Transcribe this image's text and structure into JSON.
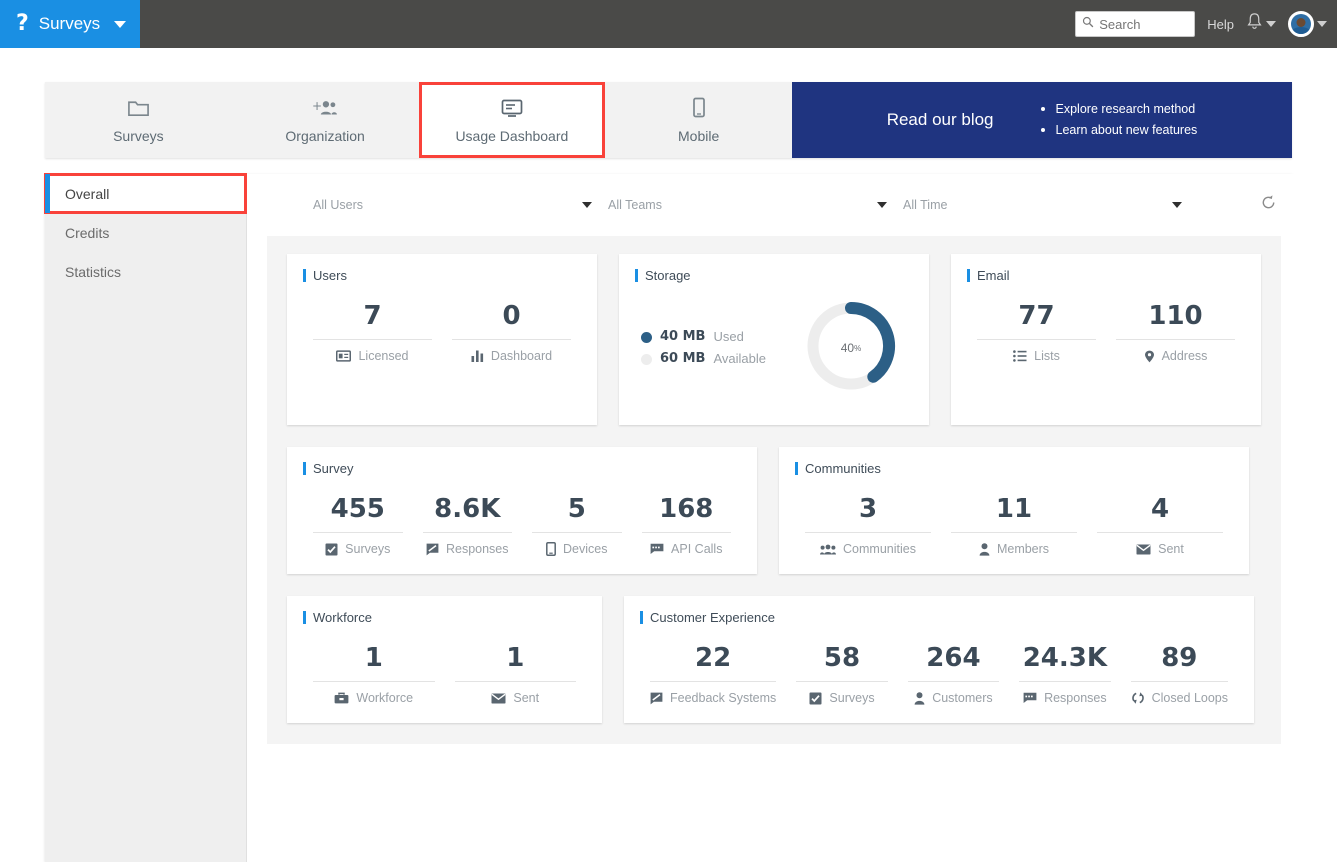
{
  "topbar": {
    "logo_glyph": "?",
    "brand": "Surveys",
    "search_placeholder": "Search",
    "search_value": "",
    "help": "Help",
    "icons": {
      "search": "search-icon",
      "bell": "bell-icon",
      "avatar": "avatar"
    }
  },
  "tabs": [
    {
      "label": "Surveys",
      "icon": "folder-icon",
      "active": false
    },
    {
      "label": "Organization",
      "icon": "add-people-icon",
      "active": false
    },
    {
      "label": "Usage Dashboard",
      "icon": "dashboard-icon",
      "active": true
    },
    {
      "label": "Mobile",
      "icon": "mobile-icon",
      "active": false
    }
  ],
  "banner": {
    "title": "Read our blog",
    "bullets": [
      "Explore research method",
      "Learn about new features"
    ],
    "bg": "#1f3480"
  },
  "sidebar": {
    "items": [
      {
        "label": "Overall",
        "active": true
      },
      {
        "label": "Credits",
        "active": false
      },
      {
        "label": "Statistics",
        "active": false
      }
    ]
  },
  "filters": {
    "users": "All Users",
    "teams": "All Teams",
    "time": "All Time",
    "refresh_icon": "refresh-icon"
  },
  "colors": {
    "accent_blue": "#1a8fe3",
    "donut_fill": "#2c5f86",
    "donut_track": "#ededed",
    "highlight_red": "#f9423a",
    "banner_navy": "#1f3480"
  },
  "cards": {
    "users": {
      "title": "Users",
      "metrics": [
        {
          "value": "7",
          "label": "Licensed",
          "icon": "id-card-icon"
        },
        {
          "value": "0",
          "label": "Dashboard",
          "icon": "bar-chart-icon"
        }
      ]
    },
    "storage": {
      "title": "Storage",
      "legend": [
        {
          "value": "40 MB",
          "label": "Used",
          "color": "#2c5f86"
        },
        {
          "value": "60 MB",
          "label": "Available",
          "color": "#ededed"
        }
      ],
      "donut": {
        "percent": 40,
        "percent_label": "40",
        "percent_unit": "%"
      }
    },
    "email": {
      "title": "Email",
      "metrics": [
        {
          "value": "77",
          "label": "Lists",
          "icon": "list-icon"
        },
        {
          "value": "110",
          "label": "Address",
          "icon": "map-pin-icon"
        }
      ]
    },
    "survey": {
      "title": "Survey",
      "metrics": [
        {
          "value": "455",
          "label": "Surveys",
          "icon": "checkbox-icon"
        },
        {
          "value": "8.6K",
          "label": "Responses",
          "icon": "response-icon"
        },
        {
          "value": "5",
          "label": "Devices",
          "icon": "mobile-icon"
        },
        {
          "value": "168",
          "label": "API Calls",
          "icon": "comment-icon"
        }
      ]
    },
    "communities": {
      "title": "Communities",
      "metrics": [
        {
          "value": "3",
          "label": "Communities",
          "icon": "group-icon"
        },
        {
          "value": "11",
          "label": "Members",
          "icon": "person-icon"
        },
        {
          "value": "4",
          "label": "Sent",
          "icon": "envelope-icon"
        }
      ]
    },
    "workforce": {
      "title": "Workforce",
      "metrics": [
        {
          "value": "1",
          "label": "Workforce",
          "icon": "briefcase-icon"
        },
        {
          "value": "1",
          "label": "Sent",
          "icon": "envelope-icon"
        }
      ]
    },
    "customer_experience": {
      "title": "Customer Experience",
      "metrics": [
        {
          "value": "22",
          "label": "Feedback Systems",
          "icon": "response-icon"
        },
        {
          "value": "58",
          "label": "Surveys",
          "icon": "checkbox-icon"
        },
        {
          "value": "264",
          "label": "Customers",
          "icon": "person-icon"
        },
        {
          "value": "24.3K",
          "label": "Responses",
          "icon": "comment-icon"
        },
        {
          "value": "89",
          "label": "Closed Loops",
          "icon": "loop-icon"
        }
      ]
    }
  },
  "chart_data": {
    "type": "pie",
    "title": "Storage",
    "categories": [
      "Used",
      "Available"
    ],
    "values": [
      40,
      60
    ],
    "labels": [
      "40 MB",
      "60 MB"
    ],
    "unit": "MB",
    "colors": [
      "#2c5f86",
      "#ededed"
    ],
    "center_label": "40%",
    "legend_position": "left"
  }
}
